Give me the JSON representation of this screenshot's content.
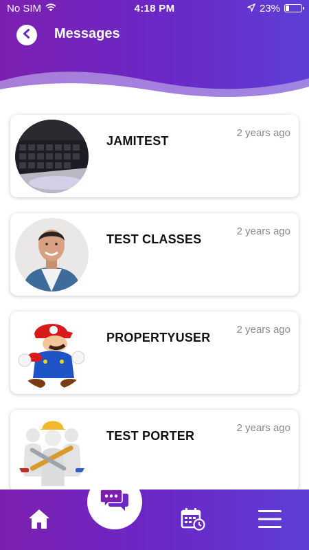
{
  "status_bar": {
    "carrier": "No SIM",
    "time": "4:18 PM",
    "battery_percent": "23%",
    "battery_level": 0.23
  },
  "header": {
    "title": "Messages",
    "back_icon": "chevron-left-icon"
  },
  "colors": {
    "brand_purple": "#6a28c8",
    "brand_purple_dark": "#7c1fb0",
    "card_bg": "#ffffff",
    "muted_text": "#8a8a8a"
  },
  "messages": [
    {
      "name": "JAMITEST",
      "time": "2 years ago",
      "avatar": "laptop-keyboard-photo"
    },
    {
      "name": "TEST CLASSES",
      "time": "2 years ago",
      "avatar": "smiling-man-photo"
    },
    {
      "name": "PROPERTYUSER",
      "time": "2 years ago",
      "avatar": "mario-character-image"
    },
    {
      "name": "TEST PORTER",
      "time": "2 years ago",
      "avatar": "workers-with-tools-image"
    }
  ],
  "bottom_nav": {
    "items": [
      "home-icon",
      "chat-bubbles-icon",
      "calendar-clock-icon",
      "menu-icon"
    ]
  }
}
